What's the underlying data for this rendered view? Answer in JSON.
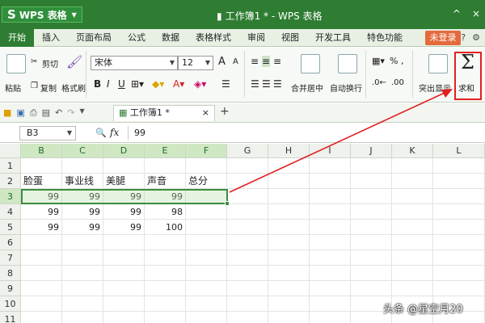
{
  "titlebar": {
    "app_name": "WPS 表格",
    "logo_glyph": "S",
    "doc_title": "工作簿1 * - WPS 表格",
    "minimize": "^",
    "close": "×"
  },
  "tabs": [
    {
      "label": "开始",
      "active": true
    },
    {
      "label": "插入"
    },
    {
      "label": "页面布局"
    },
    {
      "label": "公式"
    },
    {
      "label": "数据"
    },
    {
      "label": "表格样式"
    },
    {
      "label": "审阅"
    },
    {
      "label": "视图"
    },
    {
      "label": "开发工具"
    },
    {
      "label": "特色功能"
    }
  ],
  "login_label": "未登录",
  "ribbon": {
    "paste": "粘贴",
    "cut": "剪切",
    "copy": "复制",
    "format_painter": "格式刷",
    "font_name": "宋体",
    "font_size": "12",
    "bold": "B",
    "italic": "I",
    "underline": "U",
    "merge_center": "合并居中",
    "wrap_text": "自动换行",
    "number_format": "%",
    "highlight": "突出显示",
    "sum": "求和",
    "sum_glyph": "Σ",
    "font_grow": "A",
    "font_shrink": "A"
  },
  "qat": {
    "doc_tab": "工作簿1 *",
    "tab_close": "×",
    "new_tab": "+"
  },
  "formula_bar": {
    "cell_ref": "B3",
    "fx": "fx",
    "value": "99"
  },
  "columns": [
    "B",
    "C",
    "D",
    "E",
    "F",
    "G",
    "H",
    "I",
    "J",
    "K",
    "L"
  ],
  "rows": [
    "1",
    "2",
    "3",
    "4",
    "5",
    "6",
    "7",
    "8",
    "9",
    "10",
    "11"
  ],
  "sheet": {
    "headers": [
      "脸蛋",
      "事业线",
      "美腿",
      "声音",
      "总分"
    ],
    "data": [
      [
        "99",
        "99",
        "99",
        "99",
        ""
      ],
      [
        "99",
        "99",
        "99",
        "98",
        ""
      ],
      [
        "99",
        "99",
        "99",
        "100",
        ""
      ]
    ]
  },
  "watermark": "头条 @星空月20",
  "colors": {
    "title_green": "#2e7d32",
    "selection_green": "#3d8b3d",
    "highlight_red": "#e02020",
    "login_orange": "#e26a3c"
  }
}
